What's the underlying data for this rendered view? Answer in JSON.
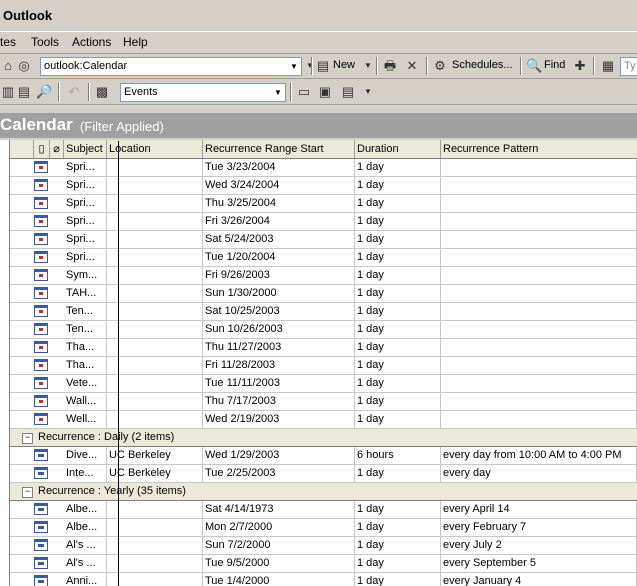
{
  "window": {
    "title": "Outlook"
  },
  "menu": [
    "tes",
    "Tools",
    "Actions",
    "Help"
  ],
  "toolbar1": {
    "address": "outlook:Calendar",
    "new_label": "New",
    "schedules_label": "Schedules...",
    "find_label": "Find",
    "type_placeholder": "Ty"
  },
  "toolbar2": {
    "view_value": "Events"
  },
  "folder": {
    "title": "Calendar",
    "filter": "(Filter Applied)"
  },
  "columns": [
    "Subject",
    "Location",
    "Recurrence Range Start",
    "Duration",
    "Recurrence Pattern"
  ],
  "rows_none": [
    {
      "subject": "Spri...",
      "location": "",
      "start": "Tue 3/23/2004",
      "duration": "1 day",
      "pattern": ""
    },
    {
      "subject": "Spri...",
      "location": "",
      "start": "Wed 3/24/2004",
      "duration": "1 day",
      "pattern": ""
    },
    {
      "subject": "Spri...",
      "location": "",
      "start": "Thu 3/25/2004",
      "duration": "1 day",
      "pattern": ""
    },
    {
      "subject": "Spri...",
      "location": "",
      "start": "Fri 3/26/2004",
      "duration": "1 day",
      "pattern": ""
    },
    {
      "subject": "Spri...",
      "location": "",
      "start": "Sat 5/24/2003",
      "duration": "1 day",
      "pattern": ""
    },
    {
      "subject": "Spri...",
      "location": "",
      "start": "Tue 1/20/2004",
      "duration": "1 day",
      "pattern": ""
    },
    {
      "subject": "Sym...",
      "location": "",
      "start": "Fri 9/26/2003",
      "duration": "1 day",
      "pattern": ""
    },
    {
      "subject": "TAH...",
      "location": "",
      "start": "Sun 1/30/2000",
      "duration": "1 day",
      "pattern": ""
    },
    {
      "subject": "Ten...",
      "location": "",
      "start": "Sat 10/25/2003",
      "duration": "1 day",
      "pattern": ""
    },
    {
      "subject": "Ten...",
      "location": "",
      "start": "Sun 10/26/2003",
      "duration": "1 day",
      "pattern": ""
    },
    {
      "subject": "Tha...",
      "location": "",
      "start": "Thu 11/27/2003",
      "duration": "1 day",
      "pattern": ""
    },
    {
      "subject": "Tha...",
      "location": "",
      "start": "Fri 11/28/2003",
      "duration": "1 day",
      "pattern": ""
    },
    {
      "subject": "Vete...",
      "location": "",
      "start": "Tue 11/11/2003",
      "duration": "1 day",
      "pattern": ""
    },
    {
      "subject": "Wall...",
      "location": "",
      "start": "Thu 7/17/2003",
      "duration": "1 day",
      "pattern": ""
    },
    {
      "subject": "Well...",
      "location": "",
      "start": "Wed 2/19/2003",
      "duration": "1 day",
      "pattern": ""
    }
  ],
  "group_daily": {
    "label": "Recurrence : Daily (2 items)"
  },
  "rows_daily": [
    {
      "subject": "Dive...",
      "location": "UC Berkeley",
      "start": "Wed 1/29/2003",
      "duration": "6 hours",
      "pattern": "every day from 10:00 AM to 4:00 PM"
    },
    {
      "subject": "Inte...",
      "location": "UC Berkeley",
      "start": "Tue 2/25/2003",
      "duration": "1 day",
      "pattern": "every day"
    }
  ],
  "group_yearly": {
    "label": "Recurrence : Yearly (35 items)"
  },
  "rows_yearly": [
    {
      "subject": "Albe...",
      "location": "",
      "start": "Sat 4/14/1973",
      "duration": "1 day",
      "pattern": "every April 14"
    },
    {
      "subject": "Albe...",
      "location": "",
      "start": "Mon 2/7/2000",
      "duration": "1 day",
      "pattern": "every February 7"
    },
    {
      "subject": "Al's ...",
      "location": "",
      "start": "Sun 7/2/2000",
      "duration": "1 day",
      "pattern": "every July 2"
    },
    {
      "subject": "Al's ...",
      "location": "",
      "start": "Tue 9/5/2000",
      "duration": "1 day",
      "pattern": "every September 5"
    },
    {
      "subject": "Anni...",
      "location": "",
      "start": "Tue 1/4/2000",
      "duration": "1 day",
      "pattern": "every January 4"
    }
  ]
}
